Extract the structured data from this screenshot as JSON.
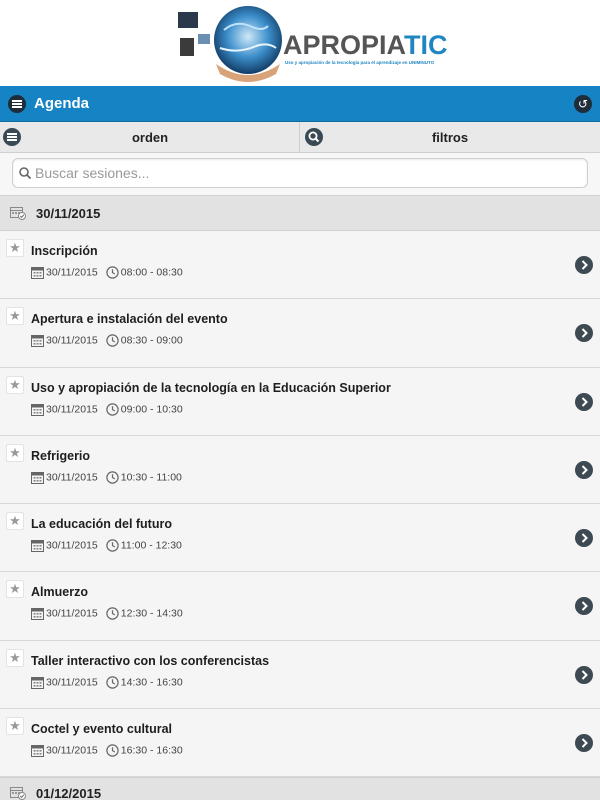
{
  "logo": {
    "text_main": "APROPIA",
    "text_accent": "TIC",
    "tagline": "Uso y apropiación de la tecnología para el aprendizaje en UNIMINUTO"
  },
  "header": {
    "title": "Agenda"
  },
  "toolbar": {
    "order_label": "orden",
    "filters_label": "filtros"
  },
  "search": {
    "placeholder": "Buscar sesiones...",
    "value": ""
  },
  "days": [
    {
      "label": "30/11/2015"
    },
    {
      "label": "01/12/2015"
    }
  ],
  "sessions": [
    {
      "title": "Inscripción",
      "date": "30/11/2015",
      "time": "08:00 - 08:30"
    },
    {
      "title": "Apertura e instalación del evento",
      "date": "30/11/2015",
      "time": "08:30 - 09:00"
    },
    {
      "title": "Uso y apropiación de la tecnología en la Educación Superior",
      "date": "30/11/2015",
      "time": "09:00 - 10:30"
    },
    {
      "title": "Refrigerio",
      "date": "30/11/2015",
      "time": "10:30 - 11:00"
    },
    {
      "title": "La educación del futuro",
      "date": "30/11/2015",
      "time": "11:00 - 12:30"
    },
    {
      "title": "Almuerzo",
      "date": "30/11/2015",
      "time": "12:30 - 14:30"
    },
    {
      "title": "Taller interactivo con los conferencistas",
      "date": "30/11/2015",
      "time": "14:30 - 16:30"
    },
    {
      "title": "Coctel y evento cultural",
      "date": "30/11/2015",
      "time": "16:30 - 16:30"
    }
  ],
  "colors": {
    "header_bg": "#1683c4",
    "icon_dark": "#3e4a52",
    "accent": "#1f86c2"
  }
}
